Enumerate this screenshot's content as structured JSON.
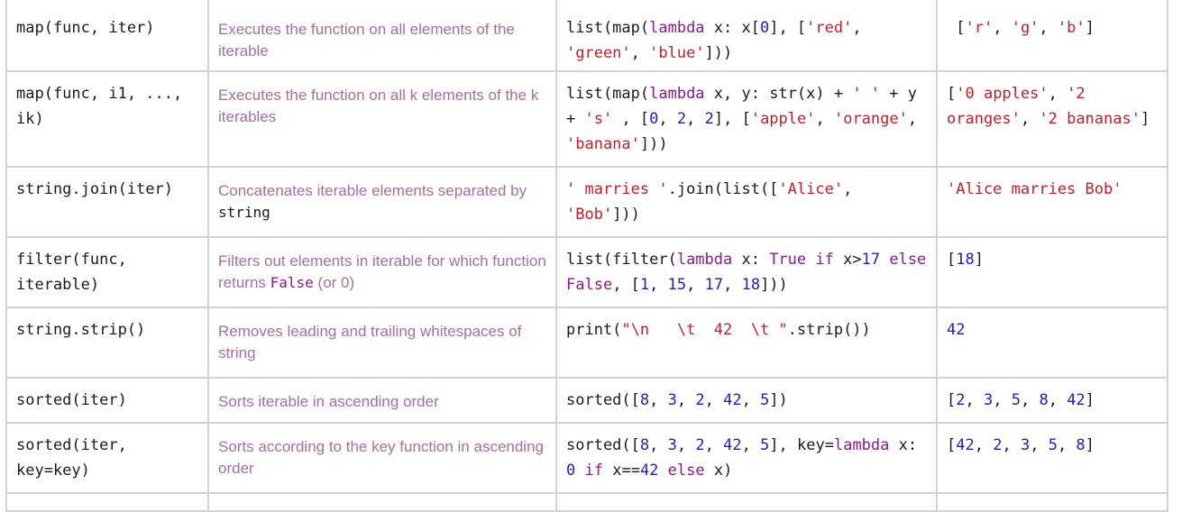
{
  "rows": [
    {
      "function": "map(func, iter)",
      "description": [
        {
          "t": "Executes the function on all elements of the iterable"
        }
      ],
      "example": [
        {
          "t": "list(map(",
          "c": "p"
        },
        {
          "t": "lambda",
          "c": "k"
        },
        {
          "t": " x: x[",
          "c": "p"
        },
        {
          "t": "0",
          "c": "n"
        },
        {
          "t": "], [",
          "c": "p"
        },
        {
          "t": "'red'",
          "c": "s"
        },
        {
          "t": ", ",
          "c": "p"
        },
        {
          "t": "'green'",
          "c": "s"
        },
        {
          "t": ", ",
          "c": "p"
        },
        {
          "t": "'blue'",
          "c": "s"
        },
        {
          "t": "]))",
          "c": "p"
        }
      ],
      "result": [
        {
          "t": " [",
          "c": "p"
        },
        {
          "t": "'r'",
          "c": "s"
        },
        {
          "t": ", ",
          "c": "p"
        },
        {
          "t": "'g'",
          "c": "s"
        },
        {
          "t": ", ",
          "c": "p"
        },
        {
          "t": "'b'",
          "c": "s"
        },
        {
          "t": "]",
          "c": "p"
        }
      ]
    },
    {
      "function": "map(func, i1, ..., ik)",
      "description": [
        {
          "t": "Executes the function on all k elements of the k iterables"
        }
      ],
      "example": [
        {
          "t": "list(map(",
          "c": "p"
        },
        {
          "t": "lambda",
          "c": "k"
        },
        {
          "t": " x, y: str(x) + ",
          "c": "p"
        },
        {
          "t": "' '",
          "c": "s"
        },
        {
          "t": " + y + ",
          "c": "p"
        },
        {
          "t": "'s'",
          "c": "s"
        },
        {
          "t": " , [",
          "c": "p"
        },
        {
          "t": "0",
          "c": "n"
        },
        {
          "t": ", ",
          "c": "p"
        },
        {
          "t": "2",
          "c": "n"
        },
        {
          "t": ", ",
          "c": "p"
        },
        {
          "t": "2",
          "c": "n"
        },
        {
          "t": "], [",
          "c": "p"
        },
        {
          "t": "'apple'",
          "c": "s"
        },
        {
          "t": ", ",
          "c": "p"
        },
        {
          "t": "'orange'",
          "c": "s"
        },
        {
          "t": ", ",
          "c": "p"
        },
        {
          "t": "'banana'",
          "c": "s"
        },
        {
          "t": "]))",
          "c": "p"
        }
      ],
      "result": [
        {
          "t": "[",
          "c": "p"
        },
        {
          "t": "'0 apples'",
          "c": "s"
        },
        {
          "t": ", ",
          "c": "p"
        },
        {
          "t": "'2 oranges'",
          "c": "s"
        },
        {
          "t": ", ",
          "c": "p"
        },
        {
          "t": "'2 bananas'",
          "c": "s"
        },
        {
          "t": "]",
          "c": "p"
        }
      ]
    },
    {
      "function": "string.join(iter)",
      "description": [
        {
          "t": "Concatenates iterable elements separated by "
        },
        {
          "t": "string",
          "code": "dark"
        }
      ],
      "example": [
        {
          "t": "' marries '",
          "c": "s"
        },
        {
          "t": ".join(list([",
          "c": "p"
        },
        {
          "t": "'Alice'",
          "c": "s"
        },
        {
          "t": ", ",
          "c": "p"
        },
        {
          "t": "'Bob'",
          "c": "s"
        },
        {
          "t": "]))",
          "c": "p"
        }
      ],
      "result": [
        {
          "t": "'Alice marries Bob'",
          "c": "s"
        }
      ]
    },
    {
      "function": "filter(func, iterable)",
      "description": [
        {
          "t": "Filters out elements in iterable for which function returns "
        },
        {
          "t": "False",
          "code": "kw"
        },
        {
          "t": " (or 0)"
        }
      ],
      "example": [
        {
          "t": "list(filter(",
          "c": "p"
        },
        {
          "t": "lambda",
          "c": "k"
        },
        {
          "t": " x: ",
          "c": "p"
        },
        {
          "t": "True",
          "c": "k"
        },
        {
          "t": " ",
          "c": "p"
        },
        {
          "t": "if",
          "c": "k"
        },
        {
          "t": " x>",
          "c": "p"
        },
        {
          "t": "17",
          "c": "n"
        },
        {
          "t": " ",
          "c": "p"
        },
        {
          "t": "else",
          "c": "k"
        },
        {
          "t": " ",
          "c": "p"
        },
        {
          "t": "False",
          "c": "k"
        },
        {
          "t": ", [",
          "c": "p"
        },
        {
          "t": "1",
          "c": "n"
        },
        {
          "t": ", ",
          "c": "p"
        },
        {
          "t": "15",
          "c": "n"
        },
        {
          "t": ", ",
          "c": "p"
        },
        {
          "t": "17",
          "c": "n"
        },
        {
          "t": ", ",
          "c": "p"
        },
        {
          "t": "18",
          "c": "n"
        },
        {
          "t": "]))",
          "c": "p"
        }
      ],
      "result": [
        {
          "t": "[",
          "c": "p"
        },
        {
          "t": "18",
          "c": "n"
        },
        {
          "t": "]",
          "c": "p"
        }
      ]
    },
    {
      "function": "string.strip()",
      "description": [
        {
          "t": "Removes leading and trailing whitespaces of string"
        }
      ],
      "example": [
        {
          "t": "print(",
          "c": "p"
        },
        {
          "t": "\"\\n   \\t  42  \\t \"",
          "c": "s"
        },
        {
          "t": ".strip())",
          "c": "p"
        }
      ],
      "result": [
        {
          "t": "42",
          "c": "n"
        }
      ]
    },
    {
      "function": "sorted(iter)",
      "description": [
        {
          "t": "Sorts iterable in ascending order"
        }
      ],
      "example": [
        {
          "t": "sorted([",
          "c": "p"
        },
        {
          "t": "8",
          "c": "n"
        },
        {
          "t": ", ",
          "c": "p"
        },
        {
          "t": "3",
          "c": "n"
        },
        {
          "t": ", ",
          "c": "p"
        },
        {
          "t": "2",
          "c": "n"
        },
        {
          "t": ", ",
          "c": "p"
        },
        {
          "t": "42",
          "c": "n"
        },
        {
          "t": ", ",
          "c": "p"
        },
        {
          "t": "5",
          "c": "n"
        },
        {
          "t": "])",
          "c": "p"
        }
      ],
      "result": [
        {
          "t": "[",
          "c": "p"
        },
        {
          "t": "2",
          "c": "n"
        },
        {
          "t": ", ",
          "c": "p"
        },
        {
          "t": "3",
          "c": "n"
        },
        {
          "t": ", ",
          "c": "p"
        },
        {
          "t": "5",
          "c": "n"
        },
        {
          "t": ", ",
          "c": "p"
        },
        {
          "t": "8",
          "c": "n"
        },
        {
          "t": ", ",
          "c": "p"
        },
        {
          "t": "42",
          "c": "n"
        },
        {
          "t": "]",
          "c": "p"
        }
      ]
    },
    {
      "function": "sorted(iter, key=key)",
      "description": [
        {
          "t": "Sorts according to the key function in ascending order"
        }
      ],
      "example": [
        {
          "t": "sorted([",
          "c": "p"
        },
        {
          "t": "8",
          "c": "n"
        },
        {
          "t": ", ",
          "c": "p"
        },
        {
          "t": "3",
          "c": "n"
        },
        {
          "t": ", ",
          "c": "p"
        },
        {
          "t": "2",
          "c": "n"
        },
        {
          "t": ", ",
          "c": "p"
        },
        {
          "t": "42",
          "c": "n"
        },
        {
          "t": ", ",
          "c": "p"
        },
        {
          "t": "5",
          "c": "n"
        },
        {
          "t": "], key=",
          "c": "p"
        },
        {
          "t": "lambda",
          "c": "k"
        },
        {
          "t": " x: ",
          "c": "p"
        },
        {
          "t": "0",
          "c": "n"
        },
        {
          "t": " ",
          "c": "p"
        },
        {
          "t": "if",
          "c": "k"
        },
        {
          "t": " x==",
          "c": "p"
        },
        {
          "t": "42",
          "c": "n"
        },
        {
          "t": " ",
          "c": "p"
        },
        {
          "t": "else",
          "c": "k"
        },
        {
          "t": " x)",
          "c": "p"
        }
      ],
      "result": [
        {
          "t": "[",
          "c": "p"
        },
        {
          "t": "42",
          "c": "n"
        },
        {
          "t": ", ",
          "c": "p"
        },
        {
          "t": "2",
          "c": "n"
        },
        {
          "t": ", ",
          "c": "p"
        },
        {
          "t": "3",
          "c": "n"
        },
        {
          "t": ", ",
          "c": "p"
        },
        {
          "t": "5",
          "c": "n"
        },
        {
          "t": ", ",
          "c": "p"
        },
        {
          "t": "8",
          "c": "n"
        },
        {
          "t": "]",
          "c": "p"
        }
      ]
    }
  ],
  "colors": {
    "description_text": "#a2709e",
    "keyword": "#8a1a8a",
    "string_literal": "#c0202a",
    "number_literal": "#2020c0",
    "border": "#d3d3d3"
  }
}
